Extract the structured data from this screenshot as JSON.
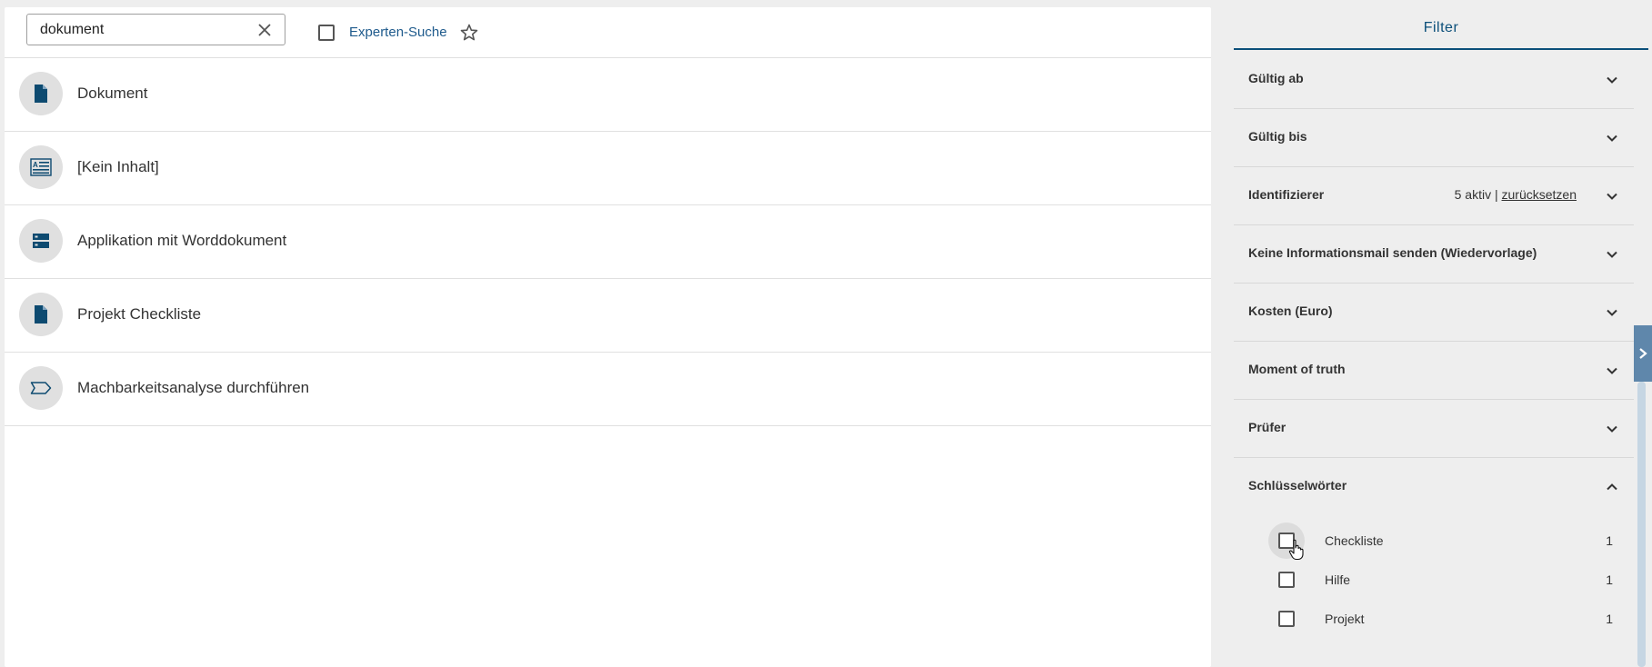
{
  "search": {
    "value": "dokument",
    "expert_label": "Experten-Suche"
  },
  "results": [
    {
      "label": "Dokument",
      "icon": "document-icon"
    },
    {
      "label": "[Kein Inhalt]",
      "icon": "form-icon"
    },
    {
      "label": "Applikation mit Worddokument",
      "icon": "application-icon"
    },
    {
      "label": "Projekt Checkliste",
      "icon": "document-icon"
    },
    {
      "label": "Machbarkeitsanalyse durchführen",
      "icon": "process-step-icon"
    }
  ],
  "filter": {
    "tab_label": "Filter",
    "sections": [
      {
        "title": "Gültig ab"
      },
      {
        "title": "Gültig bis"
      },
      {
        "title": "Identifizierer",
        "active": "5 aktiv",
        "separator": "|",
        "reset": "zurücksetzen"
      },
      {
        "title": "Keine Informationsmail senden (Wiedervorlage)"
      },
      {
        "title": "Kosten (Euro)"
      },
      {
        "title": "Moment of truth"
      },
      {
        "title": "Prüfer"
      },
      {
        "title": "Schlüsselwörter",
        "expanded": true
      }
    ],
    "keywords": [
      {
        "label": "Checkliste",
        "count": "1"
      },
      {
        "label": "Hilfe",
        "count": "1"
      },
      {
        "label": "Projekt",
        "count": "1"
      }
    ]
  },
  "colors": {
    "accent": "#0b4f7a",
    "icon": "#0d4a70",
    "link": "#1e5a8c"
  }
}
